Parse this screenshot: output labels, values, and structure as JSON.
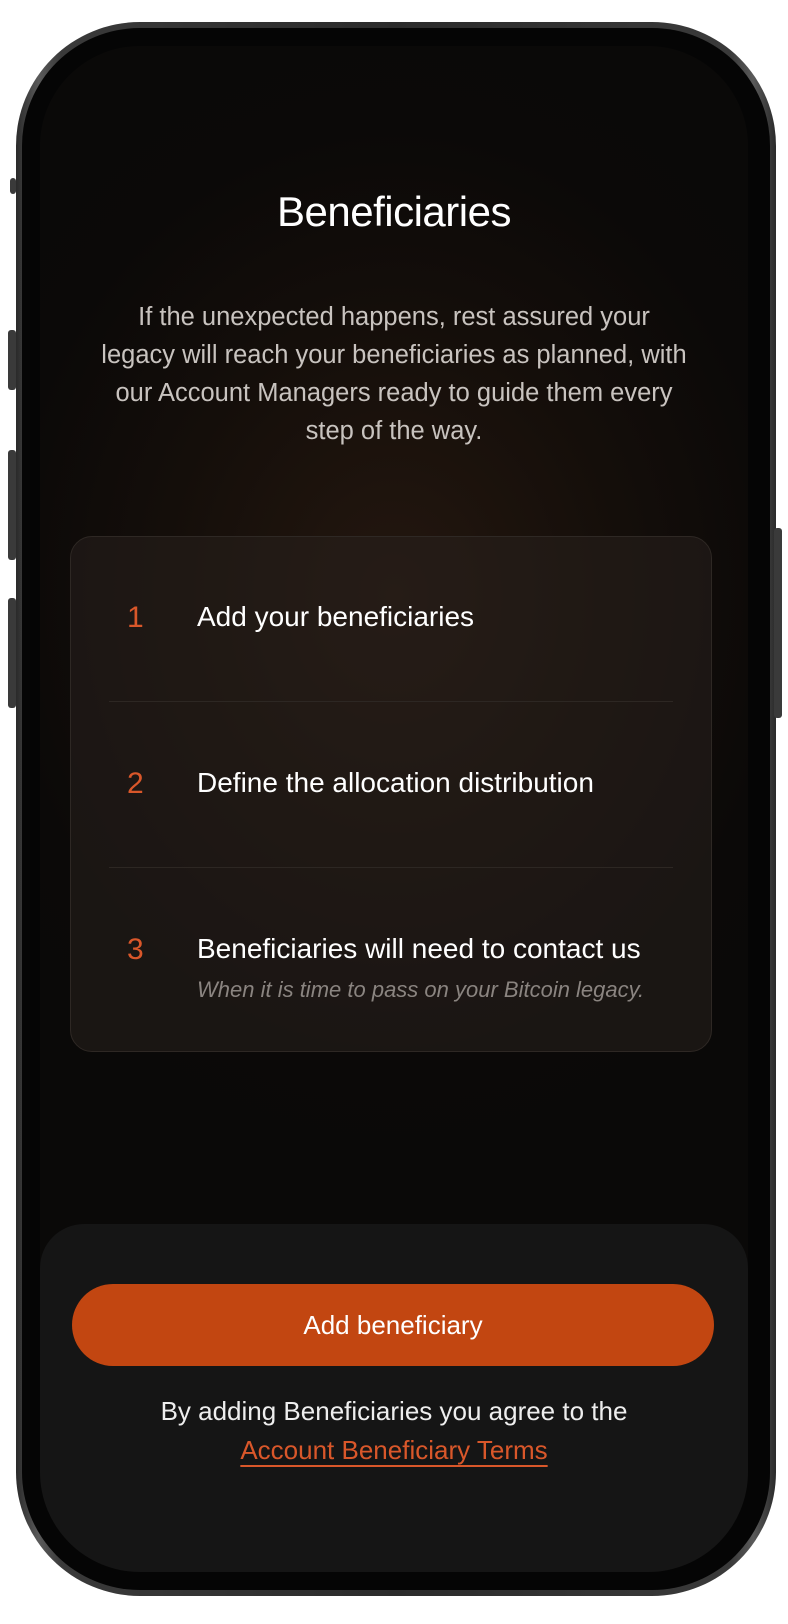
{
  "screen": {
    "title": "Beneficiaries",
    "intro": "If the unexpected happens, rest assured your legacy will reach your beneficiaries as planned, with our Account Managers ready to guide them every step of the way."
  },
  "steps": [
    {
      "number": "1",
      "label": "Add your beneficiaries",
      "sublabel": ""
    },
    {
      "number": "2",
      "label": "Define the allocation distribution",
      "sublabel": ""
    },
    {
      "number": "3",
      "label": "Beneficiaries will need to contact us",
      "sublabel": "When it is time to pass on your Bitcoin legacy."
    }
  ],
  "footer": {
    "primary_button": "Add beneficiary",
    "terms_prefix": "By adding Beneficiaries you agree to the",
    "terms_link": "Account Beneficiary Terms"
  },
  "colors": {
    "accent": "#c24611",
    "step_number": "#d9572a",
    "background": "#0b0908",
    "sheet": "#151515"
  }
}
